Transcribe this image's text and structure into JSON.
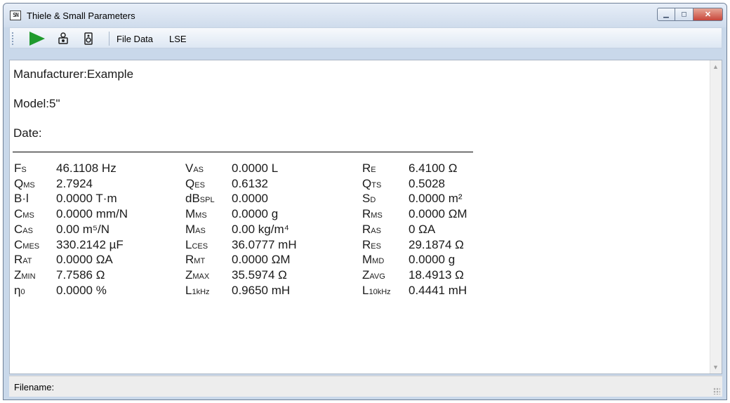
{
  "window": {
    "title": "Thiele & Small Parameters",
    "app_icon_text": "SN",
    "buttons": {
      "minimize": "▁",
      "maximize": "◻",
      "close": "✕"
    }
  },
  "toolbar": {
    "icons": [
      "play-icon",
      "driver-icon",
      "speaker-icon"
    ],
    "menu": [
      "File Data",
      "LSE"
    ]
  },
  "header": {
    "manufacturer": "Manufacturer:Example",
    "model": "Model:5\"",
    "date": "Date:"
  },
  "params": [
    [
      {
        "sym": "F",
        "sub": "S",
        "value": "46.1108 Hz"
      },
      {
        "sym": "V",
        "sub": "AS",
        "value": "0.0000 L"
      },
      {
        "sym": "R",
        "sub": "E",
        "value": "6.4100 Ω"
      }
    ],
    [
      {
        "sym": "Q",
        "sub": "MS",
        "value": "2.7924"
      },
      {
        "sym": "Q",
        "sub": "ES",
        "value": "0.6132"
      },
      {
        "sym": "Q",
        "sub": "TS",
        "value": "0.5028"
      }
    ],
    [
      {
        "sym": "B·l",
        "sub": "",
        "value": "0.0000 T·m"
      },
      {
        "sym": "dB",
        "sub": "SPL",
        "value": "0.0000"
      },
      {
        "sym": "S",
        "sub": "D",
        "value": "0.0000 m²"
      }
    ],
    [
      {
        "sym": "C",
        "sub": "MS",
        "value": "0.0000 mm/N"
      },
      {
        "sym": "M",
        "sub": "MS",
        "value": "0.0000 g"
      },
      {
        "sym": "R",
        "sub": "MS",
        "value": "0.0000 ΩM"
      }
    ],
    [
      {
        "sym": "C",
        "sub": "AS",
        "value": "0.00 m⁵/N"
      },
      {
        "sym": "M",
        "sub": "AS",
        "value": "0.00 kg/m⁴"
      },
      {
        "sym": "R",
        "sub": "AS",
        "value": "0 ΩA"
      }
    ],
    [
      {
        "sym": "C",
        "sub": "MES",
        "value": "330.2142 µF"
      },
      {
        "sym": "L",
        "sub": "CES",
        "value": "36.0777 mH"
      },
      {
        "sym": "R",
        "sub": "ES",
        "value": "29.1874 Ω"
      }
    ],
    [
      {
        "sym": "R",
        "sub": "AT",
        "value": "0.0000 ΩA"
      },
      {
        "sym": "R",
        "sub": "MT",
        "value": "0.0000 ΩM"
      },
      {
        "sym": "M",
        "sub": "MD",
        "value": "0.0000 g"
      }
    ],
    [
      {
        "sym": "Z",
        "sub": "MIN",
        "value": "7.7586 Ω"
      },
      {
        "sym": "Z",
        "sub": "MAX",
        "value": "35.5974 Ω"
      },
      {
        "sym": "Z",
        "sub": "AVG",
        "value": "18.4913 Ω"
      }
    ],
    [
      {
        "sym": "η",
        "sub": "0",
        "value": "0.0000 %"
      },
      {
        "sym": "L",
        "sub": "1kHz",
        "value": "0.9650 mH"
      },
      {
        "sym": "L",
        "sub": "10kHz",
        "value": "0.4441 mH"
      }
    ]
  ],
  "status": {
    "filename_label": "Filename:"
  }
}
